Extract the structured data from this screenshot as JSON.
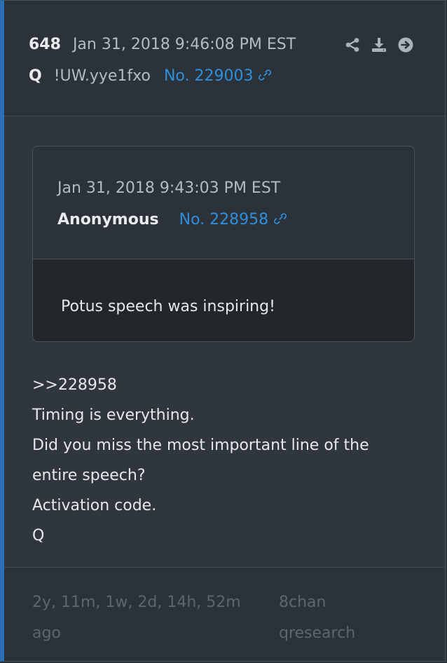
{
  "post": {
    "number": "648",
    "date": "Jan 31, 2018 9:46:08 PM EST",
    "author": "Q",
    "tripcode": "!UW.yye1fxo",
    "link_label": "No. 229003",
    "actions": [
      {
        "icon": "share-icon"
      },
      {
        "icon": "download-icon"
      },
      {
        "icon": "arrow-right-circle-icon"
      }
    ]
  },
  "quote": {
    "date": "Jan 31, 2018 9:43:03 PM EST",
    "author": "Anonymous",
    "link_label": "No. 228958",
    "text": "Potus speech was inspiring!"
  },
  "message": {
    "lines": [
      ">>228958",
      "Timing is everything.",
      "Did you miss the most important line of the",
      "entire speech?",
      "Activation code.",
      "Q"
    ]
  },
  "footer": {
    "time_ago_line1": "2y, 11m, 1w, 2d, 14h, 52m",
    "time_ago_line2": "ago",
    "site": "8chan",
    "board": "qresearch"
  },
  "colors": {
    "accent": "#2e8fdc",
    "left_bar": "#2a6fb6",
    "background": "#30363d",
    "quote_body": "#23272c",
    "muted_text": "#5d656e"
  }
}
